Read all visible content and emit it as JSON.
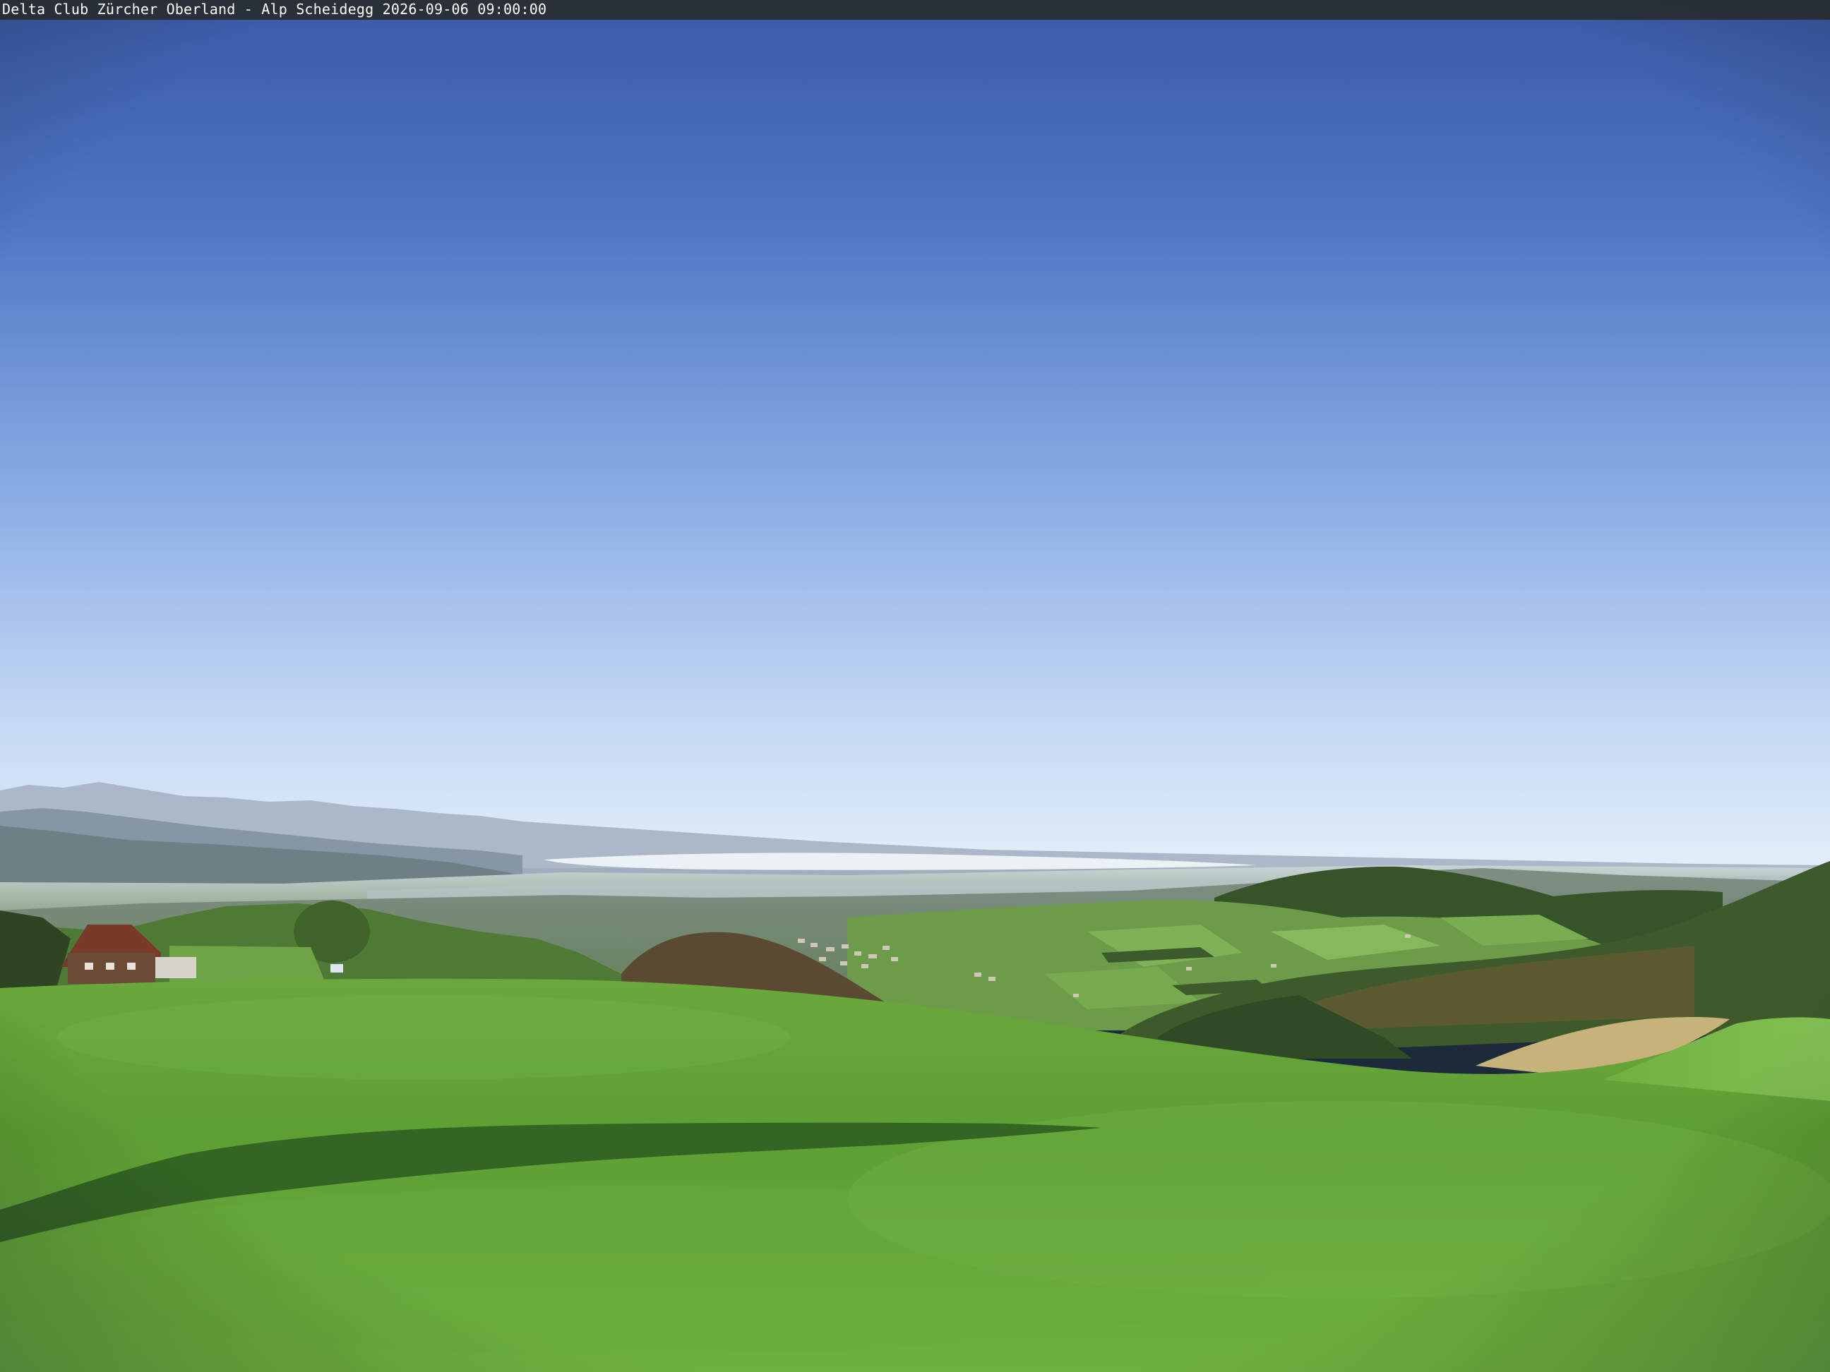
{
  "caption": {
    "text": "Delta Club Zürcher Oberland - Alp Scheidegg 2026-09-06 09:00:00"
  },
  "colors": {
    "sky_top": "#3f63b0",
    "sky_mid": "#7fa3e0",
    "sky_horizon": "#dce9f7",
    "distant_mountains": "#9aa8bf",
    "valley_haze": "#b9c6c6",
    "forest_dark": "#2f4a24",
    "meadow_far": "#5e9b3a",
    "meadow_near": "#5aa033",
    "meadow_bright": "#79b94a",
    "shadow": "#2c5a1e",
    "caption_bg": "#282c30",
    "caption_fg": "#ffffff"
  }
}
